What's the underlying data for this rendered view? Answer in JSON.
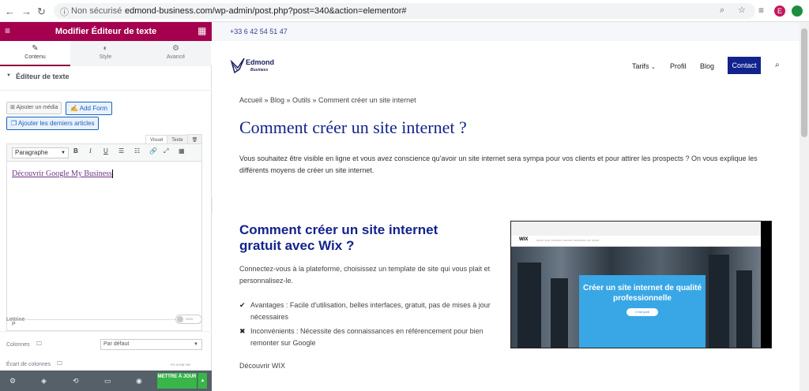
{
  "browser": {
    "security_label": "Non sécurisé",
    "url": "edmond-business.com/wp-admin/post.php?post=340&action=elementor#",
    "profile_initial": "E"
  },
  "sidebar": {
    "title": "Modifier Éditeur de texte",
    "tabs": [
      {
        "label": "Contenu",
        "icon": "pencil-icon"
      },
      {
        "label": "Style",
        "icon": "half-circle-icon"
      },
      {
        "label": "Avancé",
        "icon": "gear-icon"
      }
    ],
    "section_title": "Éditeur de texte",
    "add_media": "Ajouter un média",
    "add_form": "Add Form",
    "add_articles": "Ajouter les derniers articles",
    "editor_tabs": {
      "visual": "Visuel",
      "text": "Texte"
    },
    "format_select": "Paragraphe",
    "editor_content": "Découvrir Google My Business",
    "path": "P",
    "dropcap_label": "Lettrine",
    "dropcap_toggle": "NON",
    "columns_label": "Colonnes",
    "columns_value": "Par défaut",
    "column_gap_label": "Écart de colonnes",
    "units": "PX  %  EM  VW",
    "update_button": "METTRE À JOUR"
  },
  "site": {
    "phone": "+33 6 42 54 51 47",
    "logo_name": "Edmond",
    "logo_sub": "Business",
    "menu": [
      "Tarifs",
      "Profil",
      "Blog"
    ],
    "contact_button": "Contact",
    "breadcrumb": "Accueil » Blog » Outils » Comment créer un site internet",
    "title": "Comment créer un site internet ?",
    "intro": "Vous souhaitez être visible en ligne et vous avez conscience qu'avoir un site internet sera sympa pour vos clients et pour attirer les prospects ? On vous explique les différents moyens de créer un site internet.",
    "section_heading": "Comment créer un site internet gratuit avec Wix ?",
    "section_text": "Connectez-vous à la plateforme, choisissez un template de site qui vous plait et personnalisez-le.",
    "advantages": "Avantages : Facile d'utilisation, belles interfaces, gratuit, pas de mises à jour nécessaires",
    "drawbacks": "Inconvénients : Nécessite des connaissances en référencement pour bien remonter sur Google",
    "discover_link": "Découvrir WIX",
    "wix_image": {
      "logo": "WIX",
      "headline": "Créer un site internet de qualité professionnelle",
      "cta": "C'est parti"
    }
  }
}
